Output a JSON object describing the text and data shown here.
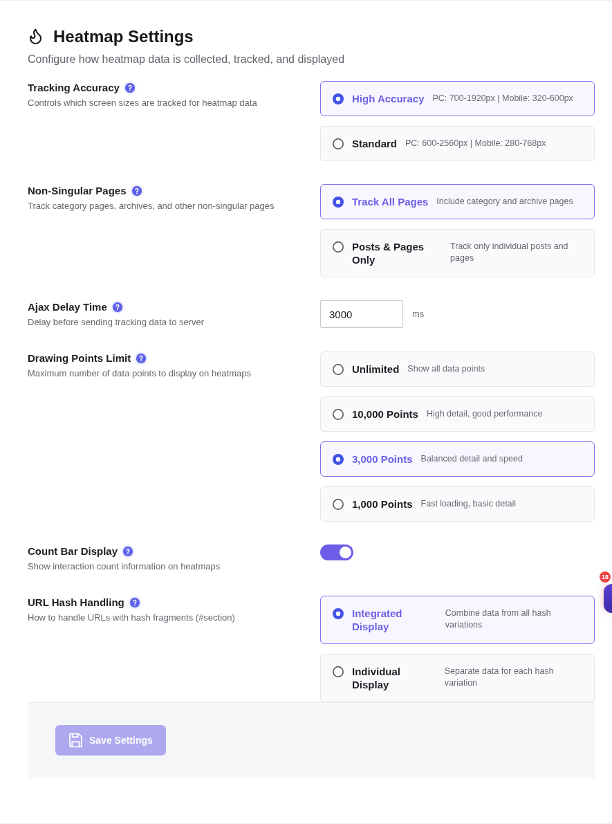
{
  "header": {
    "title": "Heatmap Settings",
    "subtitle": "Configure how heatmap data is collected, tracked, and displayed"
  },
  "settings": [
    {
      "kind": "radio",
      "label": "Tracking Accuracy",
      "description": "Controls which screen sizes are tracked for heatmap data",
      "options": [
        {
          "title": "High Accuracy",
          "description": "PC: 700-1920px | Mobile: 320-600px",
          "selected": true
        },
        {
          "title": "Standard",
          "description": "PC: 600-2560px | Mobile: 280-768px",
          "selected": false
        }
      ]
    },
    {
      "kind": "radio",
      "label": "Non-Singular Pages",
      "description": "Track category pages, archives, and other non-singular pages",
      "options": [
        {
          "title": "Track All Pages",
          "description": "Include category and archive pages",
          "selected": true
        },
        {
          "title": "Posts & Pages Only",
          "description": "Track only individual posts and pages",
          "selected": false
        }
      ]
    },
    {
      "kind": "number",
      "label": "Ajax Delay Time",
      "description": "Delay before sending tracking data to server",
      "value": "3000",
      "unit": "ms"
    },
    {
      "kind": "radio",
      "label": "Drawing Points Limit",
      "description": "Maximum number of data points to display on heatmaps",
      "options": [
        {
          "title": "Unlimited",
          "description": "Show all data points",
          "selected": false
        },
        {
          "title": "10,000 Points",
          "description": "High detail, good performance",
          "selected": false
        },
        {
          "title": "3,000 Points",
          "description": "Balanced detail and speed",
          "selected": true
        },
        {
          "title": "1,000 Points",
          "description": "Fast loading, basic detail",
          "selected": false
        }
      ]
    },
    {
      "kind": "toggle",
      "label": "Count Bar Display",
      "description": "Show interaction count information on heatmaps",
      "on": true
    },
    {
      "kind": "radio",
      "label": "URL Hash Handling",
      "description": "How to handle URLs with hash fragments (#section)",
      "options": [
        {
          "title": "Integrated Display",
          "description": "Combine data from all hash variations",
          "selected": true
        },
        {
          "title": "Individual Display",
          "description": "Separate data for each hash variation",
          "selected": false
        }
      ]
    }
  ],
  "footer": {
    "save_button": {
      "label": "Save Settings",
      "disabled": true
    }
  },
  "floating_widget": {
    "badge": "18"
  }
}
